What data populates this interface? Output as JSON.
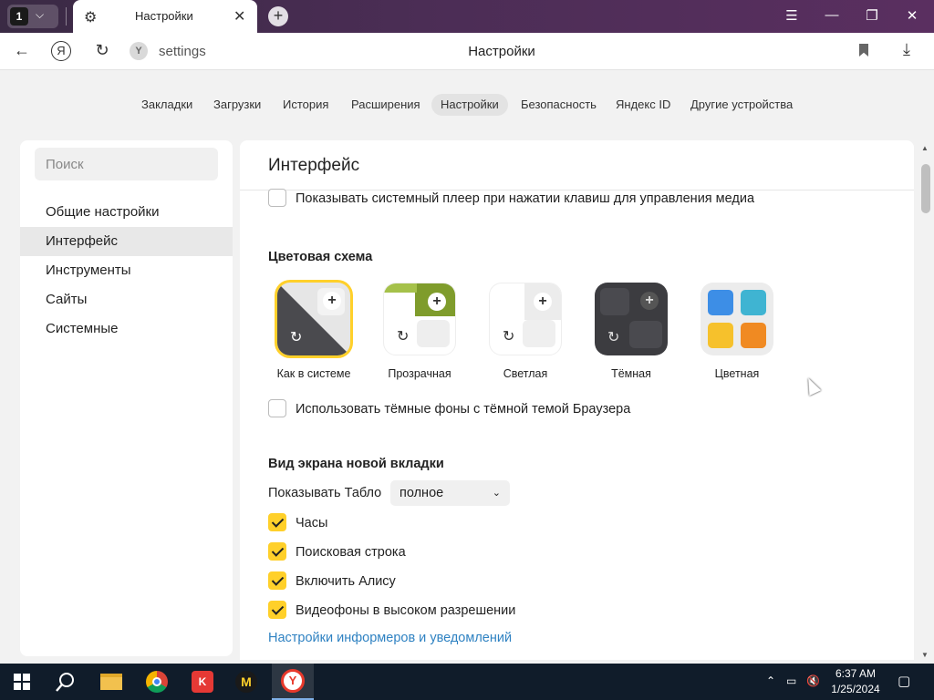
{
  "browser": {
    "tab_counter": "1",
    "tab_title": "Настройки",
    "url": "settings",
    "page_title": "Настройки"
  },
  "topnav": [
    "Закладки",
    "Загрузки",
    "История",
    "Расширения",
    "Настройки",
    "Безопасность",
    "Яндекс ID",
    "Другие устройства"
  ],
  "topnav_active": "Настройки",
  "sidebar": {
    "search_placeholder": "Поиск",
    "items": [
      "Общие настройки",
      "Интерфейс",
      "Инструменты",
      "Сайты",
      "Системные"
    ],
    "active": "Интерфейс"
  },
  "main": {
    "title": "Интерфейс",
    "media_player_label": "Показывать системный плеер при нажатии клавиш для управления медиа",
    "media_player_checked": false,
    "color_scheme_title": "Цветовая схема",
    "themes": [
      "Как в системе",
      "Прозрачная",
      "Светлая",
      "Тёмная",
      "Цветная"
    ],
    "selected_theme": "Как в системе",
    "dark_backgrounds_label": "Использовать тёмные фоны с тёмной темой Браузера",
    "dark_backgrounds_checked": false,
    "new_tab_title": "Вид экрана новой вкладки",
    "tablo_label": "Показывать Табло",
    "tablo_value": "полное",
    "options": [
      {
        "label": "Часы",
        "checked": true
      },
      {
        "label": "Поисковая строка",
        "checked": true
      },
      {
        "label": "Включить Алису",
        "checked": true
      },
      {
        "label": "Видеофоны в высоком разрешении",
        "checked": true
      }
    ],
    "informers_link": "Настройки информеров и уведомлений"
  },
  "taskbar": {
    "time": "6:37 AM",
    "date": "1/25/2024"
  },
  "colors": {
    "accent_yellow": "#ffd02a",
    "link_blue": "#2f82c2",
    "titlebar": "#4b2d55",
    "taskbar": "#101c2a"
  }
}
